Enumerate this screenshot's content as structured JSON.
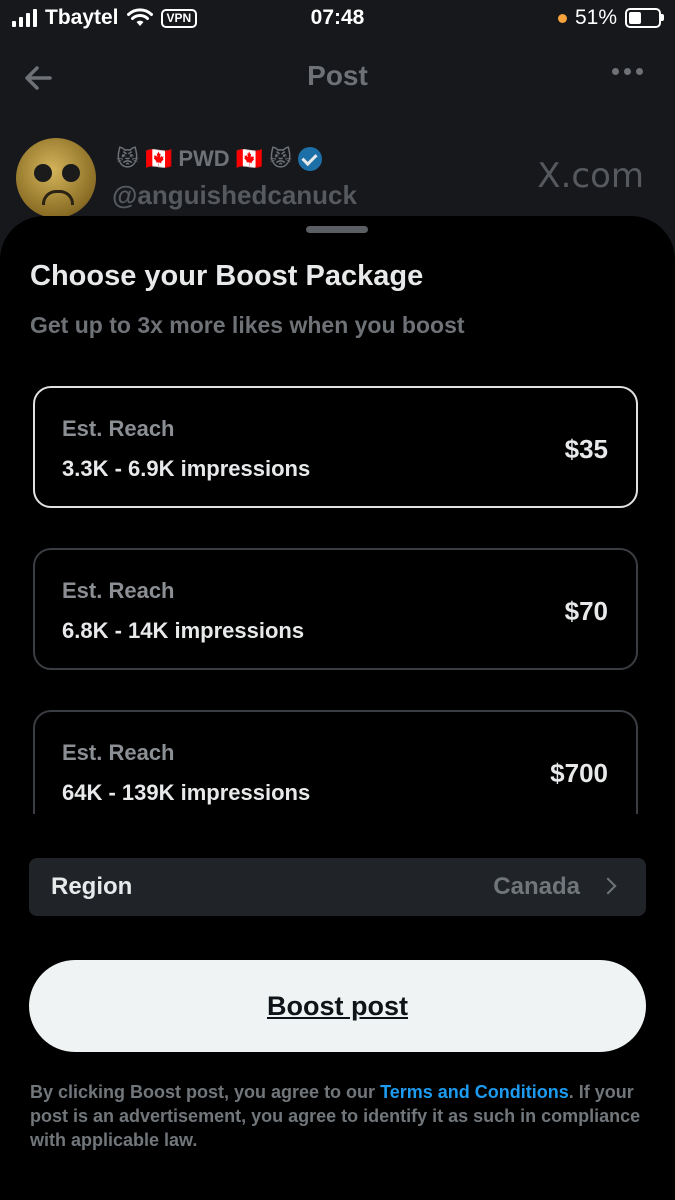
{
  "status_bar": {
    "carrier": "Tbaytel",
    "vpn": "VPN",
    "time": "07:48",
    "battery_percent": "51%",
    "battery_level": 0.51,
    "dot_color": "#f7a23b"
  },
  "header": {
    "title": "Post",
    "back_icon": "arrow-left-icon",
    "more_icon": "more-horizontal-icon"
  },
  "author": {
    "display_name": "PWD",
    "name_emojis": [
      "😾",
      "🇨🇦",
      "🇨🇦",
      "😾"
    ],
    "handle": "@anguishedcanuck",
    "site": "X.com",
    "verified_color": "#1d9bf0"
  },
  "sheet": {
    "title": "Choose your Boost Package",
    "subtitle": "Get up to 3x more likes when you boost",
    "packages": [
      {
        "label": "Est. Reach",
        "range": "3.3K - 6.9K impressions",
        "price": "$35",
        "selected": true
      },
      {
        "label": "Est. Reach",
        "range": "6.8K - 14K impressions",
        "price": "$70",
        "selected": false
      },
      {
        "label": "Est. Reach",
        "range": "64K - 139K impressions",
        "price": "$700",
        "selected": false
      }
    ],
    "region": {
      "label": "Region",
      "value": "Canada"
    },
    "boost_button": "Boost post",
    "legal": {
      "before": "By clicking Boost post, you agree to our ",
      "link": "Terms and Conditions",
      "after": ". If your post is an advertisement, you agree to identify it as such in compliance with applicable law."
    }
  },
  "colors": {
    "background": "#16181c",
    "sheet": "#000000",
    "accent_link": "#1d9bf0",
    "button_bg": "#eff3f4"
  }
}
